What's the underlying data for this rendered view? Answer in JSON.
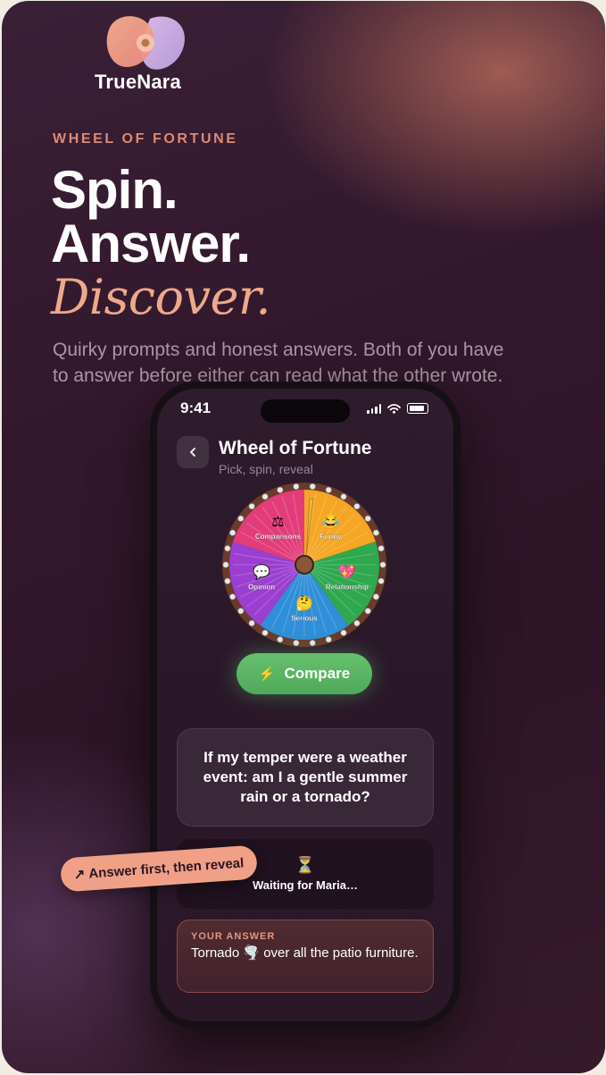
{
  "brand": {
    "name": "TrueNara"
  },
  "hero": {
    "eyebrow": "WHEEL OF FORTUNE",
    "line1": "Spin.",
    "line2": "Answer.",
    "line3": "Discover.",
    "lede": "Quirky prompts and honest answers. Both of you have to answer before either can read what the other wrote."
  },
  "status_bar": {
    "time": "9:41"
  },
  "screen_header": {
    "back_icon": "chevron-left-icon",
    "title": "Wheel of Fortune",
    "subtitle": "Pick, spin, reveal"
  },
  "wheel": {
    "segments": [
      {
        "label": "Funny",
        "emoji": "😂",
        "color": "#f5a623"
      },
      {
        "label": "Relationship",
        "emoji": "💖",
        "color": "#2fa84f"
      },
      {
        "label": "Serious",
        "emoji": "🤔",
        "color": "#2f8fd8"
      },
      {
        "label": "Opinion",
        "emoji": "💬",
        "color": "#9b3fd0"
      },
      {
        "label": "Comparisons",
        "emoji": "⚖",
        "color": "#e23d78"
      }
    ]
  },
  "compare_button": {
    "label": "Compare",
    "icon": "lightning-icon"
  },
  "question": {
    "text": "If my temper were a weather event: am I a gentle summer rain or a tornado?"
  },
  "waiting": {
    "icon": "hourglass-icon",
    "glyph": "⏳",
    "text": "Waiting for Maria…"
  },
  "your_answer": {
    "label": "YOUR ANSWER",
    "text": "Tornado 🌪️ over all the patio furniture."
  },
  "sticker": {
    "arrow": "↗",
    "text": "Answer first, then reveal"
  },
  "colors": {
    "accent": "#eda98c",
    "button_green": "#5cb866",
    "background": "#33182c"
  }
}
